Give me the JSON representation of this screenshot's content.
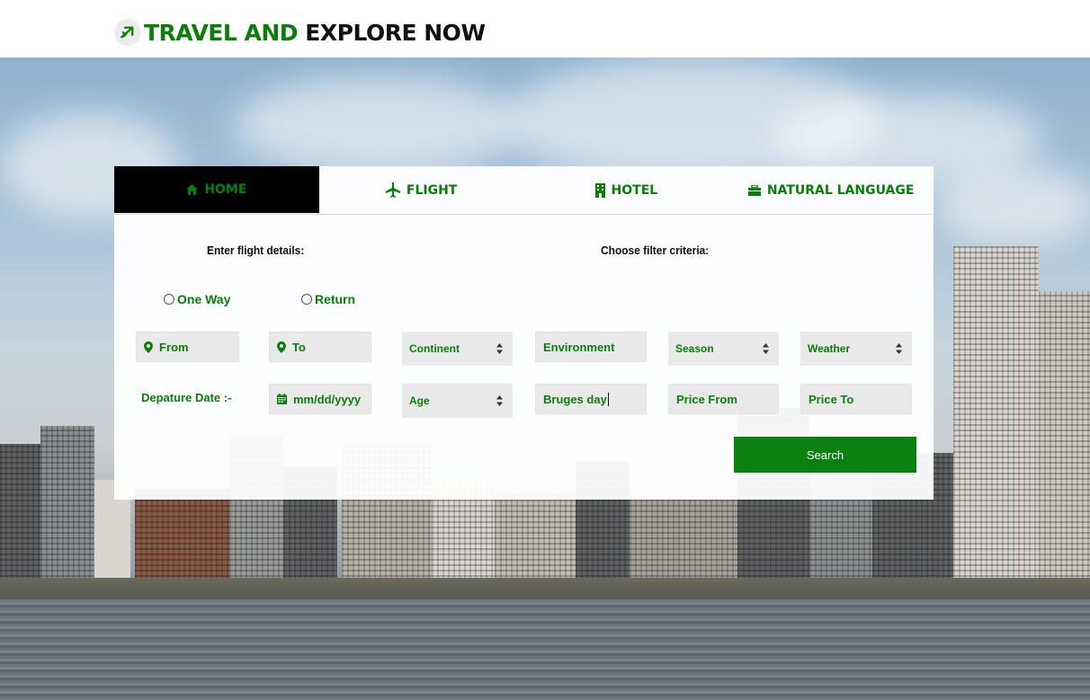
{
  "brand": {
    "title_green": "TRAVEL AND",
    "title_dark": "EXPLORE NOW",
    "logo_icon": "plane-icon"
  },
  "colors": {
    "accent": "#0a7d0a",
    "button": "#0a8010",
    "active_tab_bg": "#000000"
  },
  "tabs": [
    {
      "label": "HOME",
      "icon": "home-icon",
      "active": true
    },
    {
      "label": "FLIGHT",
      "icon": "plane-icon",
      "active": false
    },
    {
      "label": "HOTEL",
      "icon": "building-icon",
      "active": false
    },
    {
      "label": "NATURAL LANGUAGE",
      "icon": "briefcase-icon",
      "active": false
    }
  ],
  "flight": {
    "heading": "Enter flight details:",
    "one_way_label": "One Way",
    "return_label": "Return",
    "from_placeholder": "From",
    "to_placeholder": "To",
    "departure_label": "Depature Date :-",
    "date_placeholder": "mm/dd/yyyy"
  },
  "filters": {
    "heading": "Choose filter criteria:",
    "continent": "Continent",
    "environment_placeholder": "Environment",
    "season": "Season",
    "weather": "Weather",
    "age": "Age",
    "query_value": "Bruges day",
    "price_from_placeholder": "Price From",
    "price_to_placeholder": "Price To"
  },
  "search_label": "Search"
}
